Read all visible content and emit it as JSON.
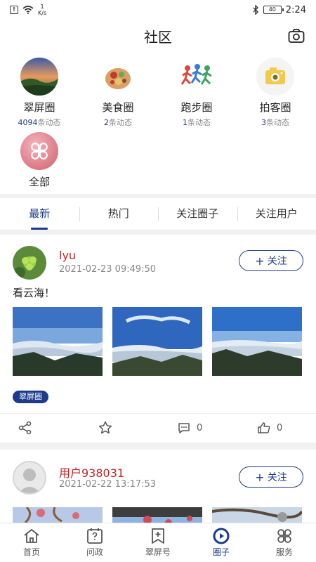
{
  "status": {
    "speed_value": "1",
    "speed_unit": "K/s",
    "battery": "40",
    "time": "2:24"
  },
  "header": {
    "title": "社区"
  },
  "circles": [
    {
      "name": "翠屏圈",
      "count": "4094",
      "suffix": "条动态"
    },
    {
      "name": "美食圈",
      "count": "2",
      "suffix": "条动态"
    },
    {
      "name": "跑步圈",
      "count": "1",
      "suffix": "条动态"
    },
    {
      "name": "拍客圈",
      "count": "3",
      "suffix": "条动态"
    },
    {
      "name": "全部"
    }
  ],
  "tabs": [
    "最新",
    "热门",
    "关注圈子",
    "关注用户"
  ],
  "posts": [
    {
      "user": "lyu",
      "time": "2021-02-23 09:49:50",
      "follow": "关注",
      "text": "看云海！",
      "tag": "翠屏圈",
      "comments": "0",
      "likes": "0"
    },
    {
      "user": "用户938031",
      "time": "2021-02-22 13:17:53",
      "follow": "关注"
    }
  ],
  "nav": [
    "首页",
    "问政",
    "翠屏号",
    "圈子",
    "服务"
  ],
  "colors": {
    "accent": "#1d3b8a",
    "username": "#c0262a"
  }
}
